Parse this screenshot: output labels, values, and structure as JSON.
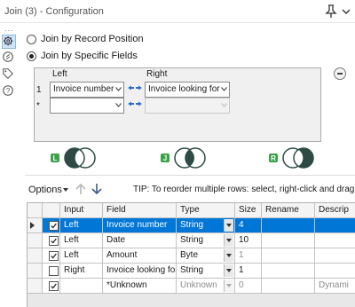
{
  "window": {
    "title": "Join (3) - Configuration"
  },
  "sidebar": {
    "overflow": "...",
    "icons": [
      "gear-icon",
      "annotation-icon",
      "tag-icon",
      "help-icon"
    ]
  },
  "join_mode": {
    "options": [
      {
        "label": "Join by Record Position",
        "selected": false
      },
      {
        "label": "Join by Specific Fields",
        "selected": true
      }
    ]
  },
  "field_grid": {
    "headers": {
      "left": "Left",
      "right": "Right"
    },
    "rows": [
      {
        "num": "1",
        "left": "Invoice number",
        "right": "Invoice looking for",
        "right_disabled": false
      },
      {
        "num": "*",
        "left": "",
        "right": "",
        "right_disabled": true
      }
    ]
  },
  "join_outputs": {
    "items": [
      {
        "letter": "L",
        "name": "left-join-icon"
      },
      {
        "letter": "J",
        "name": "inner-join-icon"
      },
      {
        "letter": "R",
        "name": "right-join-icon"
      }
    ],
    "accent": "#2e4a44",
    "badge_color": "#3aa34a"
  },
  "toolbar": {
    "options_label": "Options",
    "tip": "TIP: To reorder multiple rows: select, right-click and drag."
  },
  "select_table": {
    "columns": [
      "",
      "Input",
      "Field",
      "Type",
      "Size",
      "Rename",
      "Descrip"
    ],
    "rows": [
      {
        "checked": true,
        "input": "Left",
        "field": "Invoice number",
        "type": "String",
        "size": "4",
        "rename": "",
        "desc": "",
        "selected": true,
        "disabled": false
      },
      {
        "checked": true,
        "input": "Left",
        "field": "Date",
        "type": "String",
        "size": "10",
        "rename": "",
        "desc": "",
        "selected": false,
        "disabled": false
      },
      {
        "checked": true,
        "input": "Left",
        "field": "Amount",
        "type": "Byte",
        "size": "1",
        "rename": "",
        "desc": "",
        "selected": false,
        "disabled": false
      },
      {
        "checked": false,
        "input": "Right",
        "field": "Invoice looking for",
        "type": "String",
        "size": "1",
        "rename": "",
        "desc": "",
        "selected": false,
        "disabled": false
      },
      {
        "checked": true,
        "input": "",
        "field": "*Unknown",
        "type": "Unknown",
        "size": "0",
        "rename": "",
        "desc": "Dynami",
        "selected": false,
        "disabled": true
      }
    ],
    "selection_color": "#0077d7"
  }
}
